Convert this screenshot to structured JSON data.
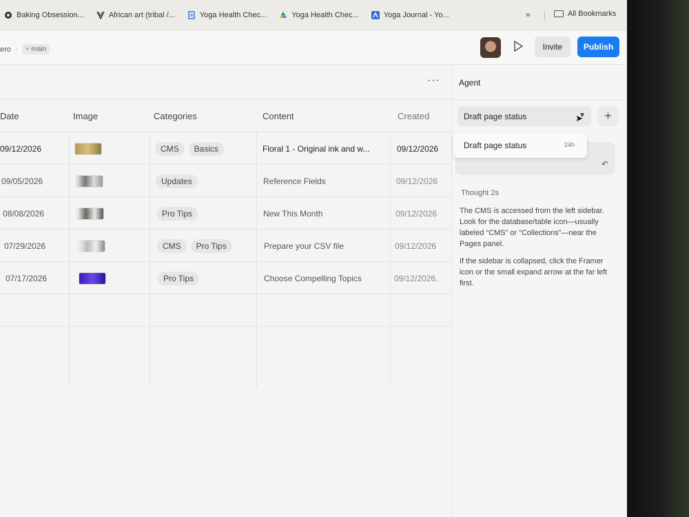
{
  "bookmarks": {
    "items": [
      {
        "label": "Baking Obsession...",
        "icon": "circle-logo-icon"
      },
      {
        "label": "African art (tribal /...",
        "icon": "tribal-logo-icon"
      },
      {
        "label": "Yoga Health Chec...",
        "icon": "doc-icon"
      },
      {
        "label": "Yoga Health Chec...",
        "icon": "drive-icon"
      },
      {
        "label": "Yoga Journal - Yo...",
        "icon": "journal-icon"
      }
    ],
    "more": "»",
    "all_label": "All Bookmarks"
  },
  "appbar": {
    "project": "ero",
    "separator": "·",
    "branch": "main",
    "invite_label": "Invite",
    "publish_label": "Publish"
  },
  "table": {
    "more_label": "···",
    "headers": {
      "date": "Date",
      "image": "Image",
      "categories": "Categories",
      "content": "Content",
      "created": "Created"
    },
    "rows": [
      {
        "date": "09/12/2026",
        "tags": [
          "CMS",
          "Basics"
        ],
        "content": "Floral 1 - Original ink and w...",
        "created": "09/12/2026"
      },
      {
        "date": "09/05/2026",
        "tags": [
          "Updates"
        ],
        "content": "Reference Fields",
        "created": "09/12/2026"
      },
      {
        "date": "08/08/2026",
        "tags": [
          "Pro Tips"
        ],
        "content": "New This Month",
        "created": "09/12/2026"
      },
      {
        "date": "07/29/2026",
        "tags": [
          "CMS",
          "Pro Tips"
        ],
        "content": "Prepare your CSV file",
        "created": "09/12/2026"
      },
      {
        "date": "07/17/2026",
        "tags": [
          "Pro Tips"
        ],
        "content": "Choose Compelling Topics",
        "created": "09/12/2026,"
      }
    ]
  },
  "agent": {
    "title": "Agent",
    "select_value": "Draft page status",
    "dropdown_item": "Draft page status",
    "dropdown_age": "24h",
    "thought_label": "Thought 2s",
    "para1": "The CMS is accessed from the left sidebar. Look for the database/table icon—usually labeled “CMS” or “Collections”—near the Pages panel.",
    "para2": "If the sidebar is collapsed, click the Framer icon or the small expand arrow at the far left first."
  },
  "colors": {
    "publish": "#1a7cf0",
    "screen_bg": "#f2f2f0"
  }
}
